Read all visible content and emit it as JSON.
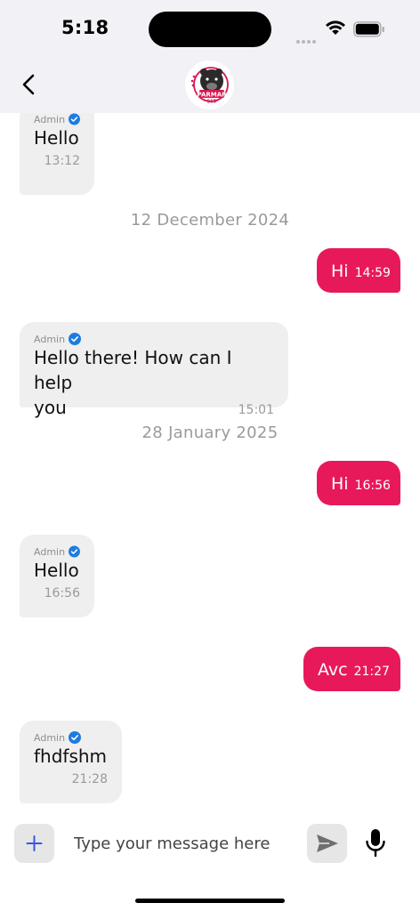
{
  "status_bar": {
    "time": "5:18"
  },
  "header": {
    "logo_text": "PARMAR",
    "logo_subtext": "555"
  },
  "messages": [
    {
      "direction": "in",
      "sender": "Admin",
      "text": "Hello",
      "time": "13:12"
    },
    {
      "type": "date",
      "text": "12 December 2024"
    },
    {
      "direction": "out",
      "text": "Hi",
      "time": "14:59"
    },
    {
      "direction": "in",
      "sender": "Admin",
      "text_line1": "Hello there! How can I help",
      "text_line2": "you",
      "time": "15:01"
    },
    {
      "type": "date",
      "text": "28 January 2025"
    },
    {
      "direction": "out",
      "text": "Hi",
      "time": "16:56"
    },
    {
      "direction": "in",
      "sender": "Admin",
      "text": "Hello",
      "time": "16:56"
    },
    {
      "direction": "out",
      "text": "Avc",
      "time": "21:27"
    },
    {
      "direction": "in",
      "sender": "Admin",
      "text": "fhdfshm",
      "time": "21:28"
    }
  ],
  "input": {
    "placeholder": "Type your message here",
    "value": ""
  },
  "colors": {
    "accent": "#e8195b",
    "incoming_bubble": "#efefef",
    "bar_background": "#f2f2f6",
    "verified": "#1e7be0",
    "attach_icon": "#3b55e6"
  }
}
